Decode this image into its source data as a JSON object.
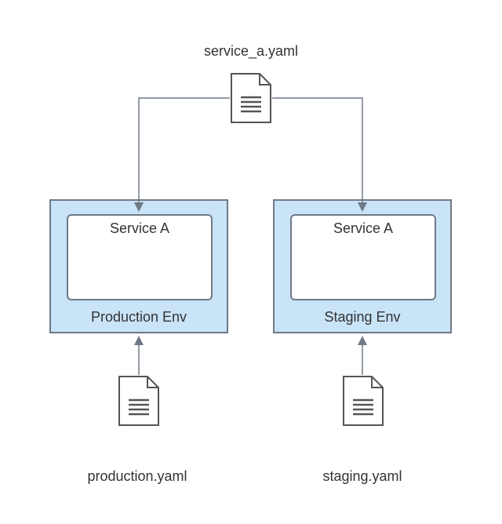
{
  "top_file": {
    "label": "service_a.yaml"
  },
  "left_env": {
    "label": "Production Env",
    "service_label": "Service A"
  },
  "right_env": {
    "label": "Staging Env",
    "service_label": "Service A"
  },
  "left_file": {
    "label": "production.yaml"
  },
  "right_file": {
    "label": "staging.yaml"
  },
  "colors": {
    "env_fill": "#c9e3f7",
    "stroke": "#6f7a86",
    "text": "#333333"
  }
}
